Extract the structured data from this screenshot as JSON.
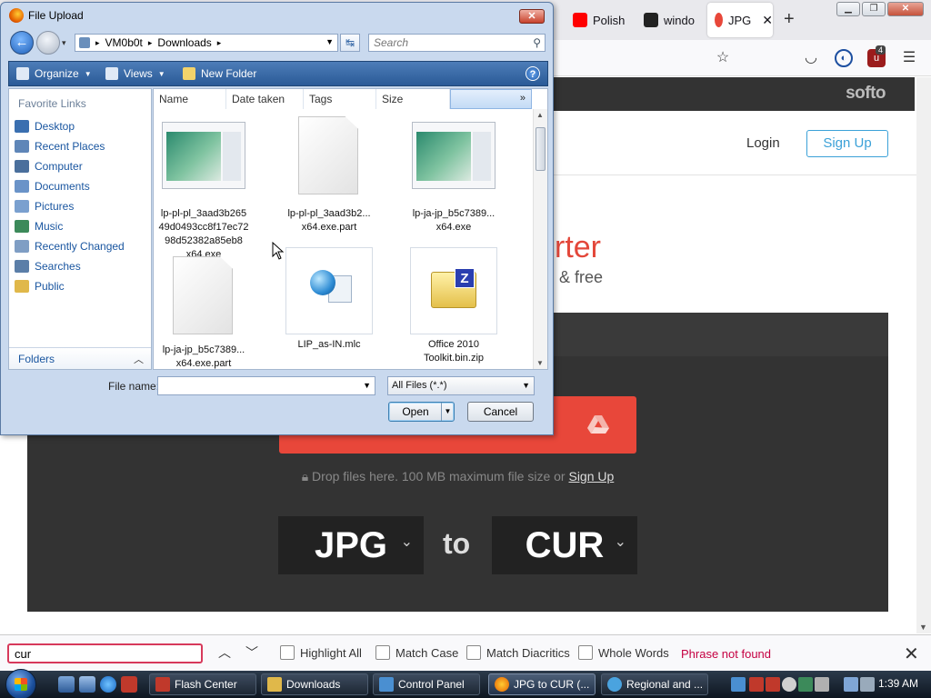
{
  "browser": {
    "tabs": [
      {
        "label": "Polish",
        "icon": "youtube-icon",
        "color": "#ff0000"
      },
      {
        "label": "windo",
        "icon": "wikipedia-icon",
        "color": "#222222"
      },
      {
        "label": "JPG",
        "icon": "softo-icon",
        "color": "#e8473a"
      }
    ],
    "close_tab": "✕",
    "new_tab": "+",
    "extension_badge": "4"
  },
  "page": {
    "logo": "softo",
    "login": "Login",
    "signup": "Sign Up",
    "heading_fragment": "rter",
    "subheading_fragment": "& free",
    "drop_text": "Drop files here. 100 MB maximum file size or",
    "drop_link": "Sign Up",
    "from_format": "JPG",
    "to_word": "to",
    "to_format": "CUR",
    "accent": "#e8473a"
  },
  "dialog": {
    "title": "File Upload",
    "close": "✕",
    "address": {
      "root": "VM0b0t",
      "folder": "Downloads"
    },
    "search_placeholder": "Search",
    "commands": {
      "organize": "Organize",
      "views": "Views",
      "new_folder": "New Folder",
      "help": "?"
    },
    "favorites_title": "Favorite Links",
    "favorites": [
      {
        "label": "Desktop",
        "icon": "desktop-icon",
        "color": "#3a6fb0"
      },
      {
        "label": "Recent Places",
        "icon": "recent-places-icon",
        "color": "#5f86b8"
      },
      {
        "label": "Computer",
        "icon": "computer-icon",
        "color": "#4a6f9c"
      },
      {
        "label": "Documents",
        "icon": "documents-icon",
        "color": "#6a93c8"
      },
      {
        "label": "Pictures",
        "icon": "pictures-icon",
        "color": "#7aa0cf"
      },
      {
        "label": "Music",
        "icon": "music-icon",
        "color": "#3c8a5a"
      },
      {
        "label": "Recently Changed",
        "icon": "recently-changed-icon",
        "color": "#7f9ec4"
      },
      {
        "label": "Searches",
        "icon": "searches-icon",
        "color": "#5b7ea8"
      },
      {
        "label": "Public",
        "icon": "public-folder-icon",
        "color": "#e0b84a"
      }
    ],
    "folders_label": "Folders",
    "columns": [
      "Name",
      "Date taken",
      "Tags",
      "Size"
    ],
    "files": [
      {
        "name": "lp-pl-pl_3aad3b26549d0493cc8f17ec7298d52382a85eb8x64.exe",
        "lines": [
          "lp-pl-pl_3aad3b265",
          "49d0493cc8f17ec72",
          "98d52382a85eb8",
          "x64.exe"
        ],
        "kind": "screenshot"
      },
      {
        "name": "lp-pl-pl_3aad3b2... x64.exe.part",
        "lines": [
          "lp-pl-pl_3aad3b2...",
          "x64.exe.part"
        ],
        "kind": "blank"
      },
      {
        "name": "lp-ja-jp_b5c7389... x64.exe",
        "lines": [
          "lp-ja-jp_b5c7389...",
          "x64.exe"
        ],
        "kind": "screenshot"
      },
      {
        "name": "lp-ja-jp_b5c7389... x64.exe.part",
        "lines": [
          "lp-ja-jp_b5c7389...",
          "x64.exe.part"
        ],
        "kind": "blank"
      },
      {
        "name": "LIP_as-IN.mlc",
        "lines": [
          "LIP_as-IN.mlc"
        ],
        "kind": "mlc"
      },
      {
        "name": "Office 2010 Toolkit.bin.zip",
        "lines": [
          "Office 2010",
          "Toolkit.bin.zip"
        ],
        "kind": "zip"
      }
    ],
    "file_name_label": "File name:",
    "file_name_value": "",
    "filter": "All Files (*.*)",
    "open": "Open",
    "cancel": "Cancel"
  },
  "findbar": {
    "query": "cur",
    "highlight_all": "Highlight All",
    "match_case": "Match Case",
    "match_diacritics": "Match Diacritics",
    "whole_words": "Whole Words",
    "status": "Phrase not found"
  },
  "taskbar": {
    "items": [
      {
        "label": "Flash Center",
        "icon": "flash-icon",
        "color": "#c0392b"
      },
      {
        "label": "Downloads",
        "icon": "folder-icon",
        "color": "#e0b84a"
      },
      {
        "label": "Control Panel",
        "icon": "control-panel-icon",
        "color": "#4a8fd1"
      },
      {
        "label": "JPG to CUR (...",
        "icon": "firefox-icon",
        "color": "#e66000"
      },
      {
        "label": "Regional and ...",
        "icon": "regional-icon",
        "color": "#4aa3df"
      }
    ],
    "clock": "1:39 AM"
  }
}
